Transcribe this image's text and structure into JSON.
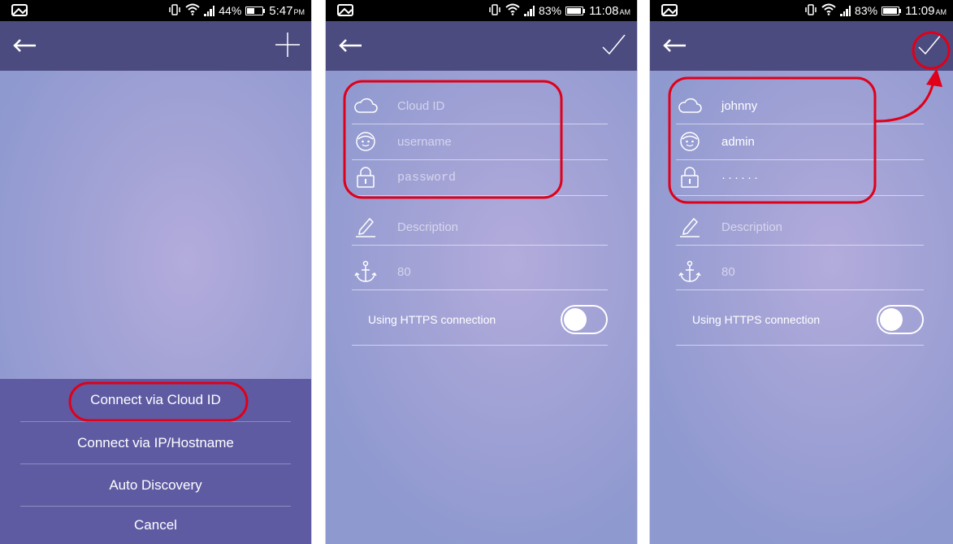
{
  "screens": [
    {
      "statusbar": {
        "battery": "44%",
        "time": "5:47",
        "ampm": "PM"
      },
      "sheet": {
        "items": [
          {
            "label": "Connect via Cloud ID"
          },
          {
            "label": "Connect via IP/Hostname"
          },
          {
            "label": "Auto Discovery"
          },
          {
            "label": "Cancel"
          }
        ]
      }
    },
    {
      "statusbar": {
        "battery": "83%",
        "time": "11:08",
        "ampm": "AM"
      },
      "form": {
        "cloud_id_placeholder": "Cloud ID",
        "username_placeholder": "username",
        "password_placeholder": "password",
        "description_placeholder": "Description",
        "port": "80",
        "https_label": "Using HTTPS connection"
      }
    },
    {
      "statusbar": {
        "battery": "83%",
        "time": "11:09",
        "ampm": "AM"
      },
      "form": {
        "cloud_id": "johnny",
        "username": "admin",
        "password": "······",
        "description_placeholder": "Description",
        "port": "80",
        "https_label": "Using HTTPS connection"
      }
    }
  ],
  "colors": {
    "appbar": "#4b4b80",
    "sheet": "#5e5ba3",
    "highlight": "#e0001a"
  },
  "icons": [
    "photo-icon",
    "vibrate-icon",
    "wifi-icon",
    "signal-icon",
    "battery-icon",
    "back-arrow-icon",
    "plus-icon",
    "checkmark-icon",
    "cloud-icon",
    "user-face-icon",
    "lock-icon",
    "pencil-icon",
    "anchor-icon"
  ]
}
